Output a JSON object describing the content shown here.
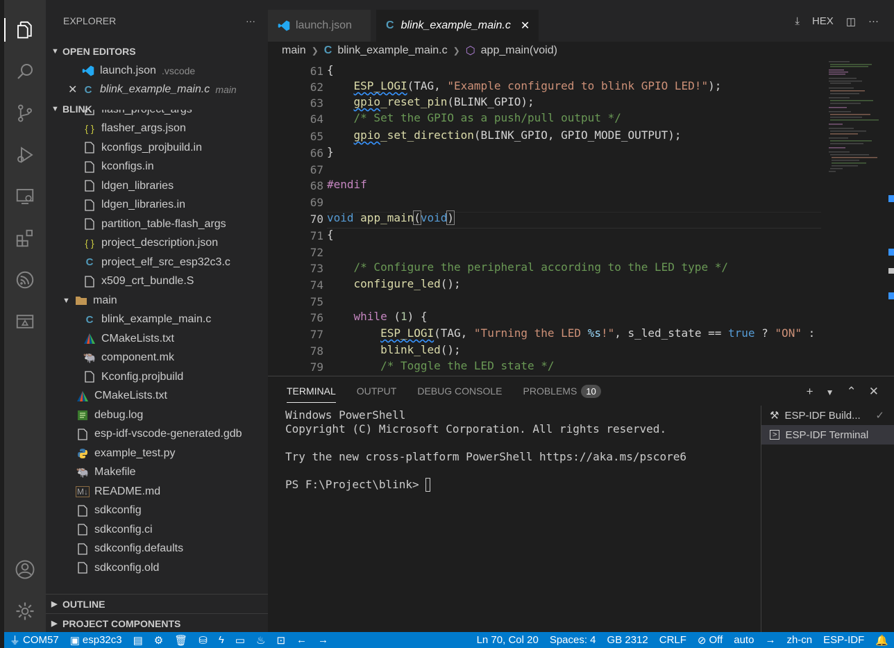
{
  "sidebar": {
    "title": "EXPLORER",
    "more": "···",
    "open_editors_title": "OPEN EDITORS",
    "open_editors": [
      {
        "name": "launch.json",
        "desc": ".vscode"
      },
      {
        "name": "blink_example_main.c",
        "desc": "main"
      }
    ],
    "project_title": "BLINK",
    "files": [
      {
        "name": "flash_project_args",
        "icon": "file"
      },
      {
        "name": "flasher_args.json",
        "icon": "json"
      },
      {
        "name": "kconfigs_projbuild.in",
        "icon": "file"
      },
      {
        "name": "kconfigs.in",
        "icon": "file"
      },
      {
        "name": "ldgen_libraries",
        "icon": "file"
      },
      {
        "name": "ldgen_libraries.in",
        "icon": "file"
      },
      {
        "name": "partition_table-flash_args",
        "icon": "file"
      },
      {
        "name": "project_description.json",
        "icon": "json"
      },
      {
        "name": "project_elf_src_esp32c3.c",
        "icon": "c"
      },
      {
        "name": "x509_crt_bundle.S",
        "icon": "file"
      }
    ],
    "main_folder": "main",
    "main_files": [
      {
        "name": "blink_example_main.c",
        "icon": "c"
      },
      {
        "name": "CMakeLists.txt",
        "icon": "cmake"
      },
      {
        "name": "component.mk",
        "icon": "gnu"
      },
      {
        "name": "Kconfig.projbuild",
        "icon": "file"
      }
    ],
    "root_files": [
      {
        "name": "CMakeLists.txt",
        "icon": "cmake"
      },
      {
        "name": "debug.log",
        "icon": "log"
      },
      {
        "name": "esp-idf-vscode-generated.gdb",
        "icon": "file"
      },
      {
        "name": "example_test.py",
        "icon": "python"
      },
      {
        "name": "Makefile",
        "icon": "gnu"
      },
      {
        "name": "README.md",
        "icon": "md"
      },
      {
        "name": "sdkconfig",
        "icon": "file"
      },
      {
        "name": "sdkconfig.ci",
        "icon": "file"
      },
      {
        "name": "sdkconfig.defaults",
        "icon": "file"
      },
      {
        "name": "sdkconfig.old",
        "icon": "file"
      }
    ],
    "outline_title": "OUTLINE",
    "components_title": "PROJECT COMPONENTS"
  },
  "tabs": {
    "inactive": "launch.json",
    "active": "blink_example_main.c",
    "hex_label": "HEX"
  },
  "breadcrumb": {
    "folder": "main",
    "file": "blink_example_main.c",
    "symbol": "app_main(void)"
  },
  "editor": {
    "line_numbers": [
      "61",
      "62",
      "63",
      "64",
      "65",
      "66",
      "67",
      "68",
      "69",
      "70",
      "71",
      "72",
      "73",
      "74",
      "75",
      "76",
      "77",
      "78",
      "79"
    ],
    "current_line": "70"
  },
  "panel": {
    "tabs": [
      "TERMINAL",
      "OUTPUT",
      "DEBUG CONSOLE",
      "PROBLEMS"
    ],
    "problems_count": "10",
    "terminal_lines": [
      "Windows PowerShell",
      "Copyright (C) Microsoft Corporation. All rights reserved.",
      "",
      "Try the new cross-platform PowerShell https://aka.ms/pscore6",
      "",
      "PS F:\\Project\\blink> "
    ],
    "terminals": [
      {
        "name": "ESP-IDF Build...",
        "icon": "tools-icon"
      },
      {
        "name": "ESP-IDF Terminal",
        "icon": "terminal-icon"
      }
    ]
  },
  "status": {
    "port": "COM57",
    "target": "esp32c3",
    "position": "Ln 70, Col 20",
    "spaces": "Spaces: 4",
    "encoding": "GB 2312",
    "eol": "CRLF",
    "format": "Off",
    "lang_mode": "auto",
    "locale": "zh-cn",
    "ext": "ESP-IDF"
  },
  "colors": {
    "status_bar": "#007acc",
    "keyword": "#569cd6",
    "function": "#dcdcaa",
    "string": "#ce9178",
    "comment": "#6a9955",
    "preprocessor": "#c586c0"
  }
}
